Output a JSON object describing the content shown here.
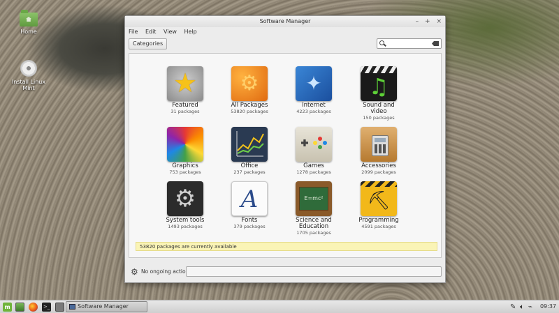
{
  "desktop": {
    "icons": [
      {
        "label": "Home",
        "icon": "folder-home-icon"
      },
      {
        "label": "Install Linux Mint",
        "icon": "disc-icon"
      }
    ]
  },
  "window": {
    "title": "Software Manager",
    "controls": {
      "minimize": "–",
      "maximize": "+",
      "close": "×"
    },
    "menu": [
      "File",
      "Edit",
      "View",
      "Help"
    ],
    "toolbar": {
      "categories_label": "Categories",
      "search_placeholder": ""
    },
    "tiles": [
      {
        "name": "Featured",
        "count": "31 packages",
        "icon": "featured-icon"
      },
      {
        "name": "All Packages",
        "count": "53820 packages",
        "icon": "all-packages-icon"
      },
      {
        "name": "Internet",
        "count": "4223 packages",
        "icon": "internet-icon"
      },
      {
        "name": "Sound and video",
        "count": "150 packages",
        "icon": "sound-video-icon"
      },
      {
        "name": "Graphics",
        "count": "753 packages",
        "icon": "graphics-icon"
      },
      {
        "name": "Office",
        "count": "237 packages",
        "icon": "office-icon"
      },
      {
        "name": "Games",
        "count": "1278 packages",
        "icon": "games-icon"
      },
      {
        "name": "Accessories",
        "count": "2099 packages",
        "icon": "accessories-icon"
      },
      {
        "name": "System tools",
        "count": "1493 packages",
        "icon": "system-tools-icon"
      },
      {
        "name": "Fonts",
        "count": "379 packages",
        "icon": "fonts-icon"
      },
      {
        "name": "Science and Education",
        "count": "1705 packages",
        "icon": "science-education-icon"
      },
      {
        "name": "Programming",
        "count": "4591 packages",
        "icon": "programming-icon"
      }
    ],
    "status_message": "53820 packages are currently available",
    "bottom": {
      "actions_label": "No ongoing actions"
    }
  },
  "taskbar": {
    "task_title": "Software Manager",
    "clock": "09:37"
  }
}
